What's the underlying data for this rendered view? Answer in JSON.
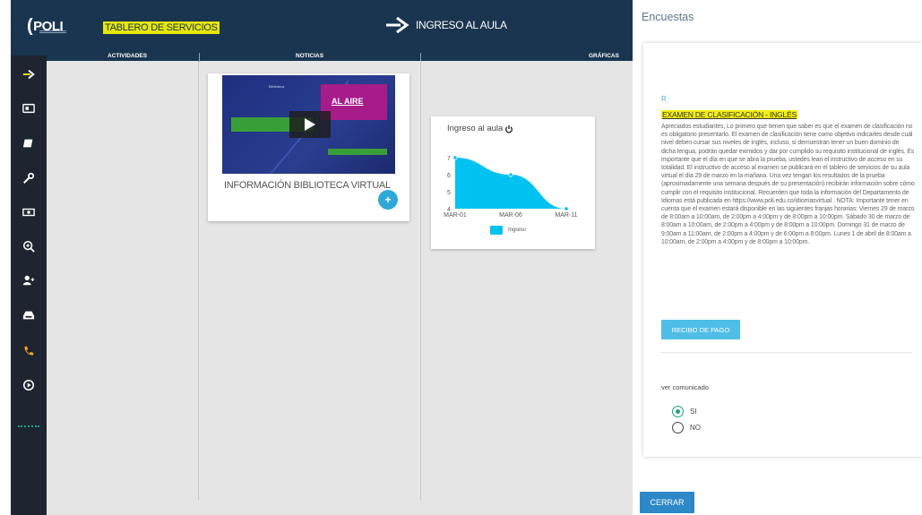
{
  "app": {
    "logo_text": "POLI",
    "board_title": "TABLERO DE SERVICIOS",
    "classroom_link": "INGRESO AL AULA",
    "accent_color": "#1a3550",
    "highlight_color": "#e6e60a"
  },
  "subnav": {
    "activities": "ACTIVIDADES",
    "news": "NOTICIAS",
    "charts": "GRÁFICAS"
  },
  "sidebar": {
    "items": [
      {
        "icon": "arrow-right-icon"
      },
      {
        "icon": "id-card-icon"
      },
      {
        "icon": "book-icon"
      },
      {
        "icon": "wrench-icon"
      },
      {
        "icon": "money-icon"
      },
      {
        "icon": "zoom-in-icon"
      },
      {
        "icon": "add-user-icon"
      },
      {
        "icon": "inbox-icon"
      },
      {
        "icon": "phone-icon"
      },
      {
        "icon": "play-circle-icon"
      }
    ]
  },
  "video_card": {
    "thumb_small_text": "Biblioteca",
    "thumb_on_air": "AL AIRE",
    "title": "INFORMACIÓN BIBLIOTECA VIRTUAL",
    "add_label": "+"
  },
  "chart_data": {
    "type": "area",
    "title": "Ingreso al aula",
    "categories": [
      "MAR-01",
      "MAR-06",
      "MAR-11"
    ],
    "series": [
      {
        "name": "Ingreso",
        "values": [
          7,
          6,
          4
        ],
        "color": "#00c2f0"
      }
    ],
    "ylim": [
      4,
      7
    ],
    "yticks": [
      "7",
      "6",
      "5",
      "4"
    ],
    "legend": "bottom",
    "grid": false
  },
  "panel": {
    "heading": "Encuestas",
    "r_mark": "R",
    "exam_title": "EXAMEN DE CLASIFICACIÓN - INGLÉS",
    "exam_body": "Apreciados estudiantes, Lo primero que tienen que saber es que el examen de clasificación no es obligatorio presentarlo. El examen de clasificación tiene como objetivo indicarles desde cuál nivel deben cursar sus niveles de inglés, incluso, si demuestran tener un buen dominio de dicha lengua, podrán quedar eximidos y dar por cumplido su requisito institucional de inglés. Es importante que el día en que se abra la prueba, ustedes lean el instructivo de acceso en su totalidad. El instructivo de acceso al examen se publicará en el tablero de servicios de su aula virtual el día 29 de marzo en la mañana. Una vez tengan los resultados de la prueba (aproximadamente una semana después de su presentación) recibirán información sobre cómo cumplir con el requisito institucional. Recuerden que toda la información del Departamento de Idiomas está publicada en https://www.poli.edu.co/idiomasvirtual . NOTA: Importante tener en cuenta que el examen estará disponible en las siguientes franjas horarias: Viernes 29 de marzo de 8:00am a 10:00am, de 2:00pm a 4:00pm y de 8:00pm a 10:00pm. Sábado 30 de marzo de 8:00am a 10:00am, de 2:00pm a 4:00pm y de 8:00pm a 10:00pm. Domingo 31 de marzo de 9:00am a 11:00am, de 2:00pm a 4:00pm y de 6:00pm a 8:00pm. Lunes 1 de abril de 8:00am a 10:00am, de 2:00pm a 4:00pm y de 8:00pm a 10:00pm.",
    "receipt_button": "RECIBO DE PAGO",
    "view_label": "ver comunicado",
    "options": [
      {
        "label": "SI",
        "checked": true
      },
      {
        "label": "NO",
        "checked": false
      }
    ],
    "close_button": "CERRAR"
  }
}
